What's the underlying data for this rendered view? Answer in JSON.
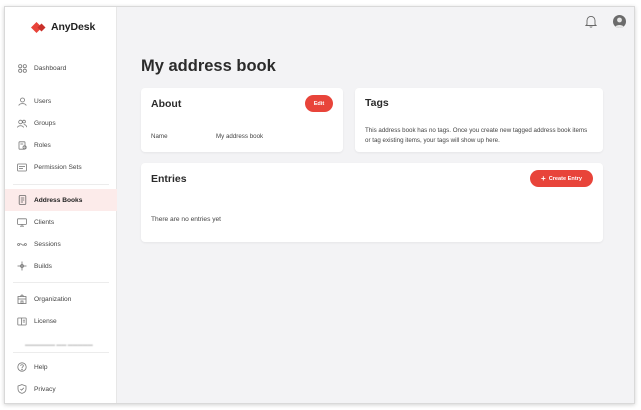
{
  "brand": {
    "name": "AnyDesk",
    "accent": "#e8443a"
  },
  "sidebar": {
    "items": [
      {
        "key": "dashboard",
        "label": "Dashboard",
        "icon": "dashboard-icon"
      },
      {
        "key": "users",
        "label": "Users",
        "icon": "user-icon"
      },
      {
        "key": "groups",
        "label": "Groups",
        "icon": "groups-icon"
      },
      {
        "key": "roles",
        "label": "Roles",
        "icon": "roles-icon"
      },
      {
        "key": "permission-sets",
        "label": "Permission Sets",
        "icon": "permission-sets-icon"
      },
      {
        "key": "address-books",
        "label": "Address Books",
        "icon": "address-book-icon",
        "active": true
      },
      {
        "key": "clients",
        "label": "Clients",
        "icon": "monitor-icon"
      },
      {
        "key": "sessions",
        "label": "Sessions",
        "icon": "sessions-icon"
      },
      {
        "key": "builds",
        "label": "Builds",
        "icon": "builds-icon"
      },
      {
        "key": "organization",
        "label": "Organization",
        "icon": "organization-icon"
      },
      {
        "key": "license",
        "label": "License",
        "icon": "license-icon"
      },
      {
        "key": "help",
        "label": "Help",
        "icon": "help-icon"
      },
      {
        "key": "privacy",
        "label": "Privacy",
        "icon": "privacy-icon"
      }
    ]
  },
  "header": {
    "bell_icon": "bell-icon",
    "avatar_icon": "avatar-icon"
  },
  "page": {
    "title": "My address book"
  },
  "about": {
    "title": "About",
    "edit_label": "Edit",
    "name_label": "Name",
    "name_value": "My address book"
  },
  "tags": {
    "title": "Tags",
    "empty_text": "This address book has no tags. Once you create new tagged address book items or tag existing items, your tags will show up here."
  },
  "entries": {
    "title": "Entries",
    "create_label": "Create Entry",
    "empty_text": "There are no entries yet"
  }
}
